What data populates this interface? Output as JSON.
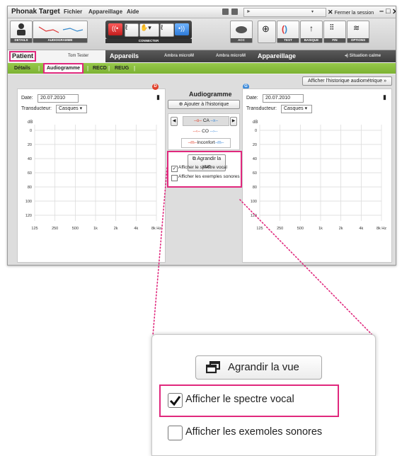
{
  "window": {
    "app_title": "Phonak Target",
    "menu": [
      "Fichier",
      "Appareillage",
      "Aide"
    ],
    "close_session": "Fermer la session"
  },
  "toolbar": {
    "details": "DETAILS",
    "audiogramme": "AUDIOGRAMME",
    "connecter": "CONNECTER",
    "acc": "ACC",
    "test": "TEST",
    "basique": "BASIQUE",
    "fin": "FIN",
    "options": "OPTIONS"
  },
  "tabs": {
    "patient": "Patient",
    "patient_name": "Tom Tester",
    "appareils": "Appareils",
    "device_right": "Ambra microM",
    "device_left": "Ambra microM",
    "appareillage": "Appareillage",
    "situation": "Situation calme"
  },
  "subtabs": [
    "Détails",
    "Audiogramme",
    "RECD",
    "REUG"
  ],
  "audiogram": {
    "title": "Audiogramme",
    "history_btn": "Afficher l'historique audiométrique",
    "add_history": "Ajouter à l'historique",
    "right_badge": "D",
    "left_badge": "G",
    "date_label": "Date:",
    "date": "20.07.2010",
    "transducer_label": "Transducteur:",
    "transducer": "Casques",
    "legend": {
      "ca": "CA",
      "co": "CO",
      "inconfort": "Inconfort"
    },
    "enlarge": "Agrandir la vue",
    "show_speech": "Afficher le spectre vocal",
    "show_sound": "Afficher les exemples sonores",
    "y_unit": "dB",
    "y_ticks": [
      "0",
      "20",
      "40",
      "60",
      "80",
      "100",
      "120"
    ],
    "x_ticks": [
      "125",
      "250",
      "500",
      "1k",
      "2k",
      "4k",
      "8k Hz"
    ],
    "colors": {
      "right": "#e0402a",
      "left": "#3a88d8",
      "highlight": "#e0287d"
    }
  },
  "zoom": {
    "enlarge": "Agrandir la vue",
    "show_speech": "Afficher le spectre vocal",
    "show_sound": "Afficher les exemoles sonores"
  }
}
